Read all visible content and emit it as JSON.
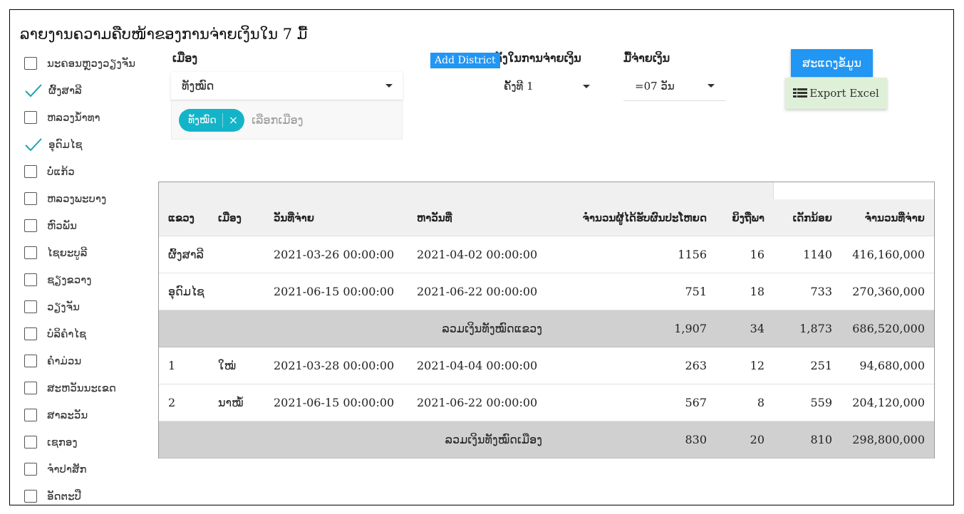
{
  "title": "ລາຍງານຄວາມຄືບໜ້າຂອງການຈ່າຍເງິນໃນ 7 ມື້",
  "provinces": [
    {
      "label": "ນະຄອນຫຼວງວຽງຈັນ",
      "checked": false
    },
    {
      "label": "ຜົ້ງສາລີ",
      "checked": true
    },
    {
      "label": "ຫລວງນໍ້າທາ",
      "checked": false
    },
    {
      "label": "ອຸດົມໄຊ",
      "checked": true
    },
    {
      "label": "ບໍ່ແກ້ວ",
      "checked": false
    },
    {
      "label": "ຫລວງພະບາງ",
      "checked": false
    },
    {
      "label": "ຫົວພັນ",
      "checked": false
    },
    {
      "label": "ໄຊຍະບູລີ",
      "checked": false
    },
    {
      "label": "ຊຽງຂວາງ",
      "checked": false
    },
    {
      "label": "ວຽງຈັນ",
      "checked": false
    },
    {
      "label": "ບໍລິຄໍາໄຊ",
      "checked": false
    },
    {
      "label": "ຄໍາມ່ວນ",
      "checked": false
    },
    {
      "label": "ສະຫວັນນະເຂດ",
      "checked": false
    },
    {
      "label": "ສາລະວັນ",
      "checked": false
    },
    {
      "label": "ເຊກອງ",
      "checked": false
    },
    {
      "label": "ຈໍາປາສັກ",
      "checked": false
    },
    {
      "label": "ອັດຕະປື",
      "checked": false
    }
  ],
  "district": {
    "label": "ເມືອງ",
    "selected": "ທັງໝົດ",
    "chip": "ທັງໝົດ",
    "placeholder": "ເລືອກເມືອງ"
  },
  "add_district_label": "Add District",
  "round": {
    "label": "ຄັ້ງໃນການຈ່າຍເງິນ",
    "selected": "ຄັ້ງທີ 1"
  },
  "pay_day": {
    "label": "ມື້ຈ່າຍເງິນ",
    "selected": "=07 ວັນ"
  },
  "show_button": "ສະແດງຂໍ້ມູນ",
  "export_button": "Export Excel",
  "table": {
    "headers": [
      "ແຂວງ",
      "ເມືອງ",
      "ວັນທີ່ຈ່າຍ",
      "ຫາວັນທີ່",
      "ຈໍານວນຜູ້ໄດ້ຮັບຜົນປະໂຫຍດ",
      "ຍິງຖືພາ",
      "ເດັກນ້ອຍ",
      "ຈໍານວນທີ່ຈ່າຍ"
    ],
    "province_rows": [
      [
        "ຜົ້ງສາລີ",
        "",
        "2021-03-26 00:00:00",
        "2021-04-02 00:00:00",
        "1156",
        "16",
        "1140",
        "416,160,000"
      ],
      [
        "ອຸດົມໄຊ",
        "",
        "2021-06-15 00:00:00",
        "2021-06-22 00:00:00",
        "751",
        "18",
        "733",
        "270,360,000"
      ]
    ],
    "province_total": {
      "label": "ລວມເງິນທັງໝົດແຂວງ",
      "values": [
        "1,907",
        "34",
        "1,873",
        "686,520,000"
      ]
    },
    "district_rows": [
      [
        "1",
        "ໃໝ່",
        "2021-03-28 00:00:00",
        "2021-04-04 00:00:00",
        "263",
        "12",
        "251",
        "94,680,000"
      ],
      [
        "2",
        "ນາໝໍ້",
        "2021-06-15 00:00:00",
        "2021-06-22 00:00:00",
        "567",
        "8",
        "559",
        "204,120,000"
      ]
    ],
    "district_total": {
      "label": "ລວມເງິນທັງໝົດເມືອງ",
      "values": [
        "830",
        "20",
        "810",
        "298,800,000"
      ]
    }
  }
}
